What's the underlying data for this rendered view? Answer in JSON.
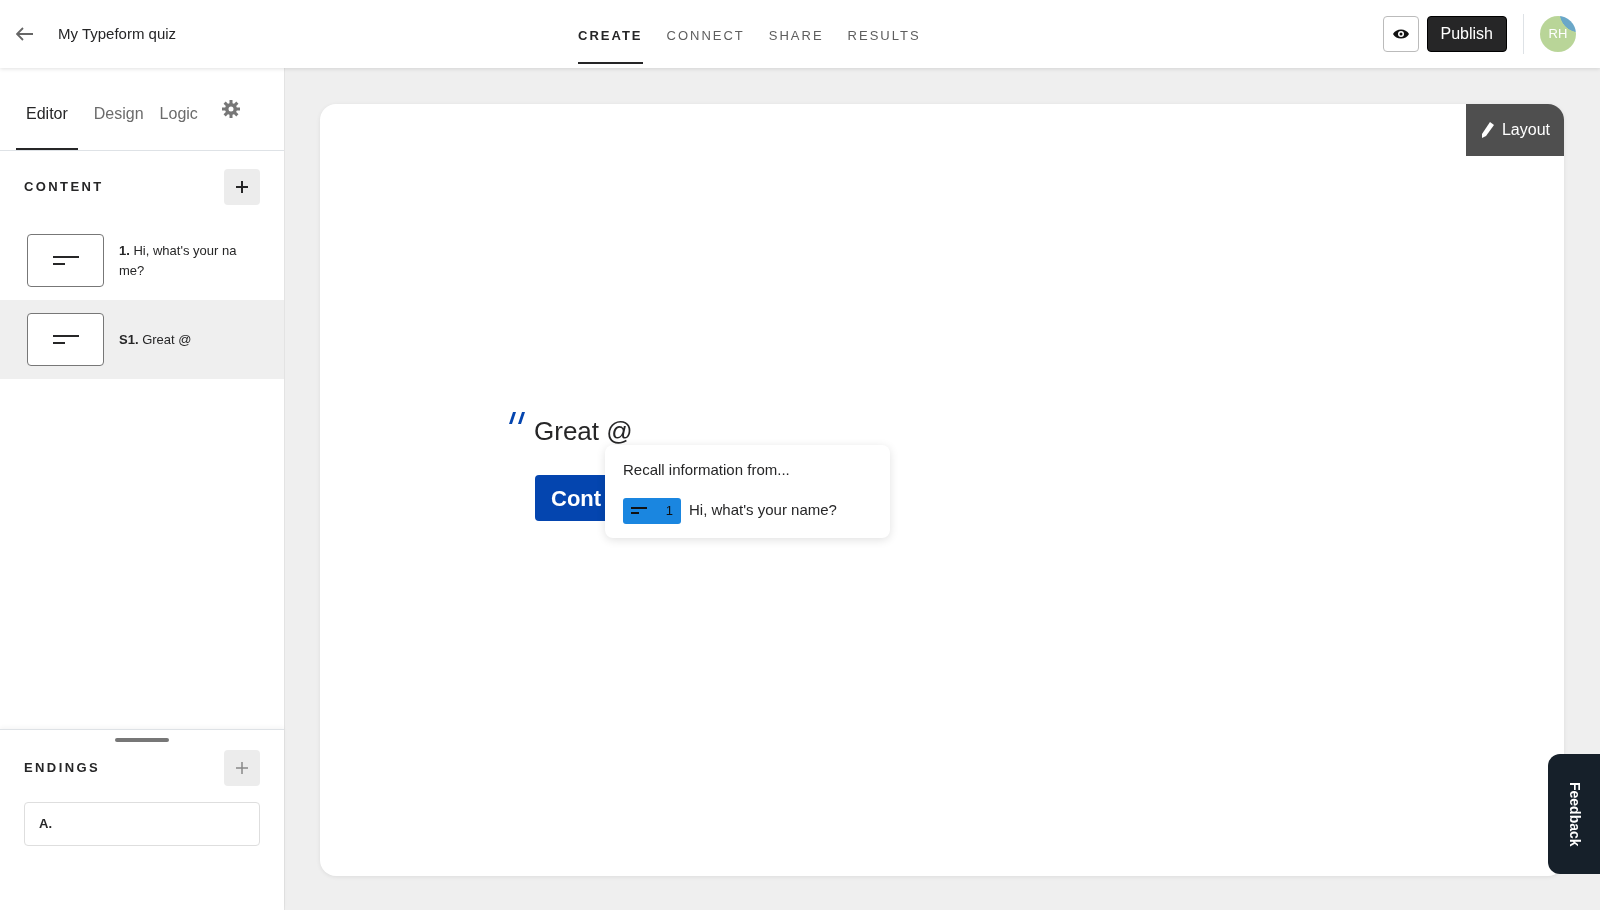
{
  "header": {
    "title": "My Typeform quiz",
    "tabs": [
      {
        "label": "CREATE",
        "selected": true
      },
      {
        "label": "CONNECT",
        "selected": false
      },
      {
        "label": "SHARE",
        "selected": false
      },
      {
        "label": "RESULTS",
        "selected": false
      }
    ],
    "publish": "Publish",
    "avatar": "RH"
  },
  "sidebar": {
    "tabs": [
      {
        "label": "Editor",
        "selected": true
      },
      {
        "label": "Design",
        "selected": false
      },
      {
        "label": "Logic",
        "selected": false
      }
    ],
    "content_heading": "CONTENT",
    "questions": [
      {
        "number": "1.",
        "text": "Hi, what's your name?",
        "selected": false
      },
      {
        "number": "S1.",
        "text": "Great @",
        "selected": true
      }
    ],
    "endings_heading": "ENDINGS",
    "endings": [
      {
        "label": "A."
      }
    ]
  },
  "canvas": {
    "layout_button": "Layout",
    "statement": "Great @",
    "continue_button": "Cont",
    "recall_popup": {
      "title": "Recall information from...",
      "items": [
        {
          "number": "1",
          "text": "Hi, what's your name?"
        }
      ]
    }
  },
  "feedback": "Feedback"
}
